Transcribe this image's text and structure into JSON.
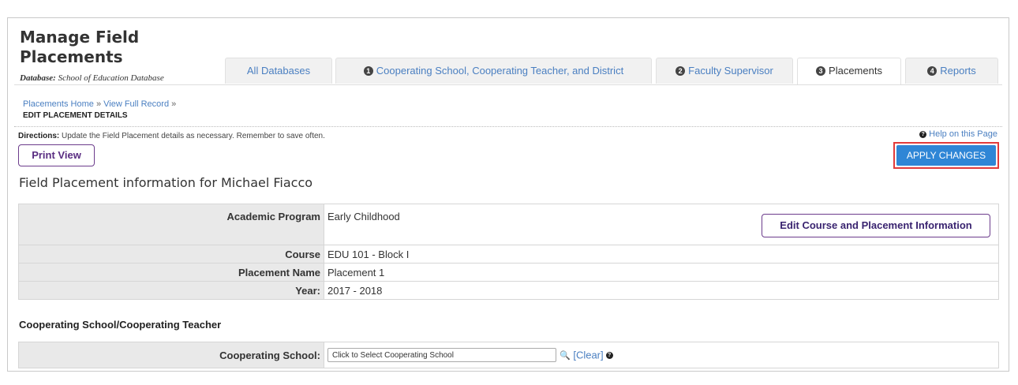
{
  "page": {
    "title_line1": "Manage Field",
    "title_line2": "Placements",
    "db_label": "Database:",
    "db_name": "School of Education Database"
  },
  "tabs": [
    {
      "label": "All Databases",
      "num": ""
    },
    {
      "label": "Cooperating School, Cooperating Teacher, and District",
      "num": "1"
    },
    {
      "label": "Faculty Supervisor",
      "num": "2"
    },
    {
      "label": "Placements",
      "num": "3"
    },
    {
      "label": "Reports",
      "num": "4"
    }
  ],
  "breadcrumb": {
    "home": "Placements Home",
    "sep1": "»",
    "record": "View Full Record",
    "sep2": "»",
    "current": "EDIT PLACEMENT DETAILS"
  },
  "directions": {
    "label": "Directions:",
    "text": "Update the Field Placement details as necessary. Remember to save often."
  },
  "help_link": "Help on this Page",
  "print_button": "Print View",
  "apply_button": "APPLY CHANGES",
  "section_title": "Field Placement information for Michael Fiacco",
  "info_rows": [
    {
      "label": "Academic Program",
      "value": "Early Childhood"
    },
    {
      "label": "Course",
      "value": "EDU 101 - Block I"
    },
    {
      "label": "Placement Name",
      "value": "Placement 1"
    },
    {
      "label": "Year:",
      "value": "2017 - 2018"
    }
  ],
  "edit_button": "Edit Course and Placement Information",
  "coop": {
    "heading": "Cooperating School/Cooperating Teacher",
    "school_label": "Cooperating School:",
    "school_value": "Click to Select Cooperating School",
    "clear_link": "[Clear]"
  },
  "colors": {
    "link": "#4a7fc1",
    "apply_bg": "#2f86d6",
    "highlight": "#e23b3b",
    "button_border": "#6c3c8c"
  },
  "icons": {
    "search": "magnifier-icon",
    "help": "question-circle-icon"
  }
}
